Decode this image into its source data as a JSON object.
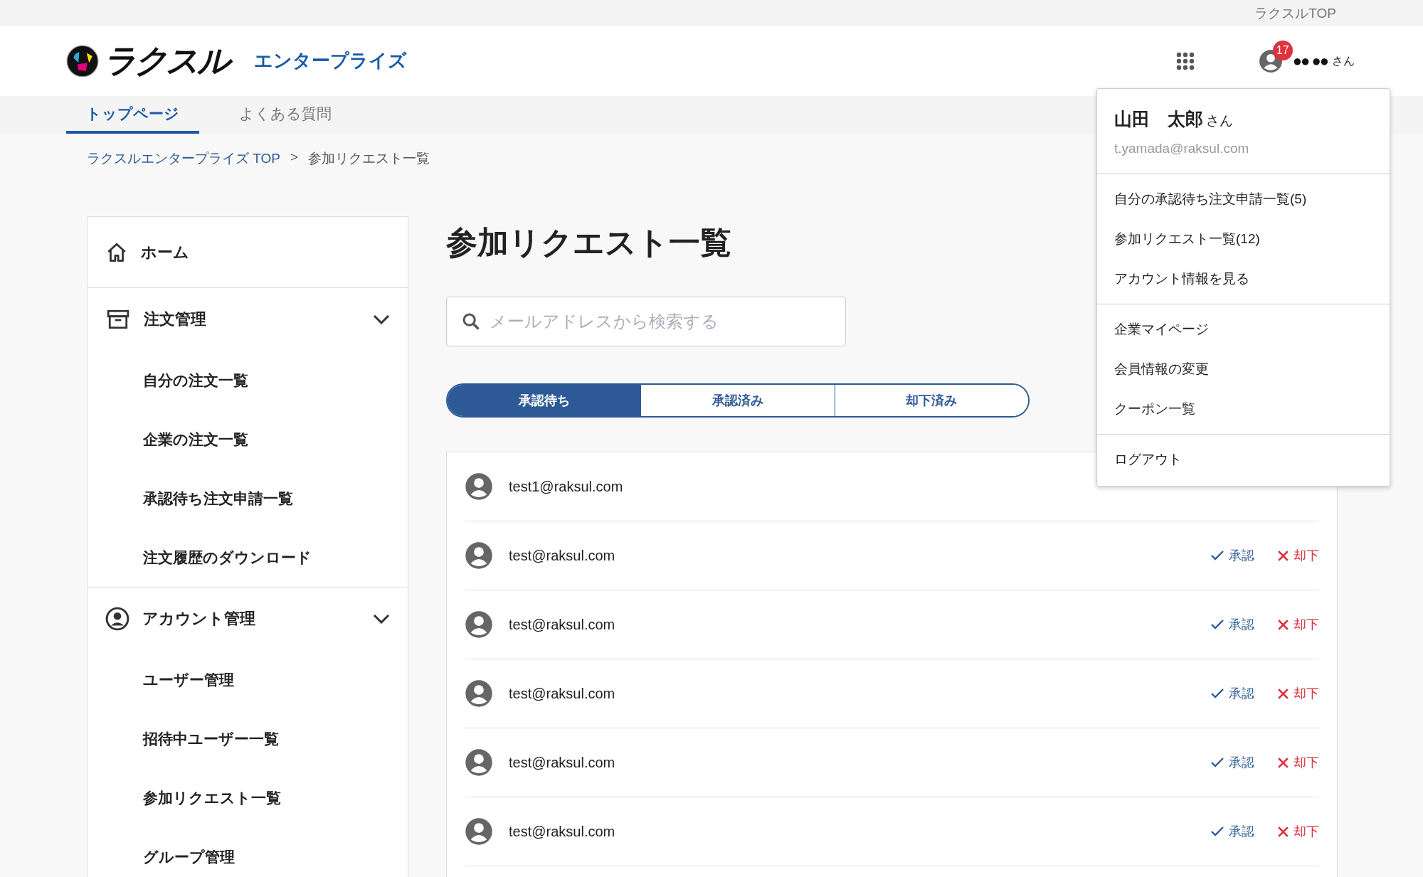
{
  "top_bar": {
    "link": "ラクスルTOP"
  },
  "header": {
    "logo_text": "ラクスル",
    "logo_sub": "エンタープライズ",
    "notification_count": "17",
    "user_name": "●● ●●",
    "user_suffix": "さん"
  },
  "nav_tabs": [
    {
      "label": "トップページ",
      "selected": true
    },
    {
      "label": "よくある質問",
      "selected": false
    }
  ],
  "breadcrumb": [
    {
      "label": "ラクスルエンタープライズ TOP",
      "kind": "link"
    },
    {
      "label": ">",
      "kind": "separator"
    },
    {
      "label": "参加リクエスト一覧",
      "kind": "current"
    }
  ],
  "sidebar": {
    "items": [
      {
        "label": "ホーム",
        "kind": "home"
      },
      {
        "label": "注文管理",
        "kind": "orders",
        "expanded": true,
        "children": [
          {
            "label": "自分の注文一覧"
          },
          {
            "label": "企業の注文一覧"
          },
          {
            "label": "承認待ち注文申請一覧"
          },
          {
            "label": "注文履歴のダウンロード"
          }
        ]
      },
      {
        "label": "アカウント管理",
        "kind": "account",
        "expanded": true,
        "children": [
          {
            "label": "ユーザー管理"
          },
          {
            "label": "招待中ユーザー一覧"
          },
          {
            "label": "参加リクエスト一覧"
          },
          {
            "label": "グループ管理"
          }
        ]
      }
    ]
  },
  "main": {
    "title": "参加リクエスト一覧",
    "search": {
      "placeholder": "メールアドレスから検索する"
    },
    "filter_tabs": [
      {
        "label": "承認待ち",
        "selected": true
      },
      {
        "label": "承認済み",
        "selected": false
      },
      {
        "label": "却下済み",
        "selected": false
      }
    ],
    "requests": [
      {
        "email": "test1@raksul.com"
      },
      {
        "email": "test@raksul.com",
        "approve": "承認",
        "reject": "却下"
      },
      {
        "email": "test@raksul.com",
        "approve": "承認",
        "reject": "却下"
      },
      {
        "email": "test@raksul.com",
        "approve": "承認",
        "reject": "却下"
      },
      {
        "email": "test@raksul.com",
        "approve": "承認",
        "reject": "却下"
      },
      {
        "email": "test@raksul.com",
        "approve": "承認",
        "reject": "却下"
      }
    ]
  },
  "user_menu": {
    "name": "山田　太郎",
    "name_suffix": "さん",
    "email": "t.yamada@raksul.com",
    "sections": [
      [
        "自分の承認待ち注文申請一覧(5)",
        "参加リクエスト一覧(12)",
        "アカウント情報を見る"
      ],
      [
        "企業マイページ",
        "会員情報の変更",
        "クーポン一覧"
      ],
      [
        "ログアウト"
      ]
    ]
  }
}
